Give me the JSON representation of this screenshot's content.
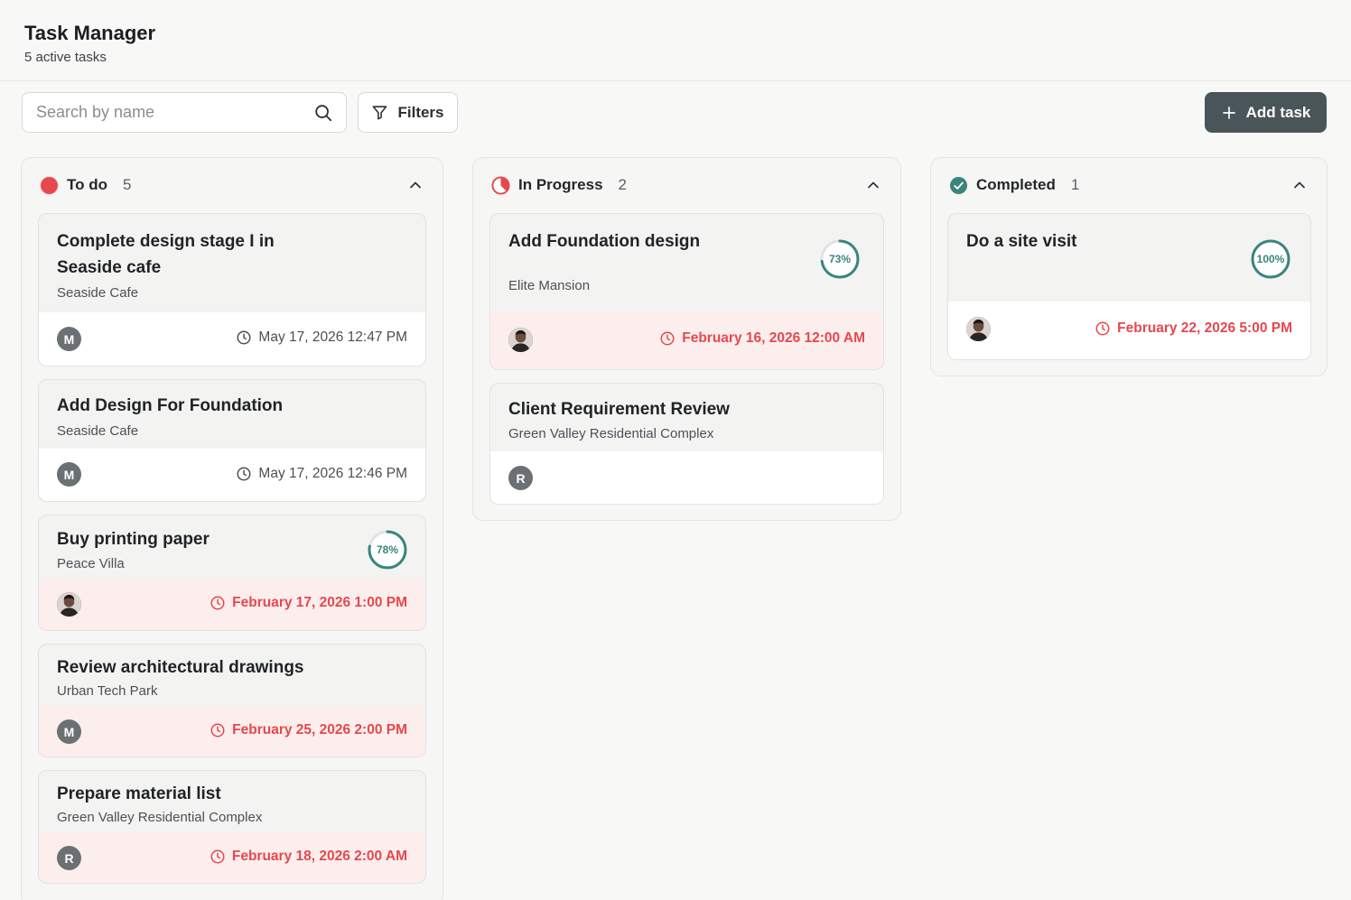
{
  "header": {
    "title": "Task Manager",
    "subtitle": "5 active tasks"
  },
  "toolbar": {
    "search_placeholder": "Search by name",
    "filters_label": "Filters",
    "add_task_label": "Add task"
  },
  "columns": [
    {
      "title": "To do",
      "count": "5",
      "status_color": "#e5484d",
      "tasks": [
        {
          "title_line1": "Complete design stage I in",
          "title_line2": "Seaside cafe",
          "project": "Seaside Cafe",
          "avatar": "M",
          "due": "May 17, 2026 12:47 PM",
          "overdue": false
        },
        {
          "title": "Add Design For Foundation",
          "project": "Seaside Cafe",
          "avatar": "M",
          "due": "May 17, 2026 12:46 PM",
          "overdue": false
        },
        {
          "title": "Buy printing paper",
          "project": "Peace Villa",
          "avatar": "photo",
          "due": "February 17, 2026 1:00 PM",
          "overdue": true,
          "progress_label": "78%",
          "progress": 0.78
        },
        {
          "title": "Review architectural drawings",
          "project": "Urban Tech Park",
          "avatar": "M",
          "due": "February 25, 2026 2:00 PM",
          "overdue": true
        },
        {
          "title": "Prepare material list",
          "project": "Green Valley Residential Complex",
          "avatar": "R",
          "due": "February 18, 2026 2:00 AM",
          "overdue": true
        }
      ]
    },
    {
      "title": "In Progress",
      "count": "2",
      "status_color": "#e5484d",
      "tasks": [
        {
          "title": "Add Foundation design",
          "project": "Elite Mansion",
          "avatar": "photo",
          "due": "February 16, 2026 12:00 AM",
          "overdue": true,
          "progress_label": "73%",
          "progress": 0.73
        },
        {
          "title": "Client Requirement Review",
          "project": "Green Valley Residential Complex",
          "avatar": "R"
        }
      ]
    },
    {
      "title": "Completed",
      "count": "1",
      "status_color": "#3a857d",
      "tasks": [
        {
          "title": "Do a site visit",
          "avatar": "photo",
          "due": "February 22, 2026 5:00 PM",
          "overdue": true,
          "progress_label": "100%",
          "progress": 1.0
        }
      ]
    }
  ],
  "colors": {
    "accent": "#4a5559",
    "overdue": "#e5484d",
    "progress": "#3a857d"
  }
}
